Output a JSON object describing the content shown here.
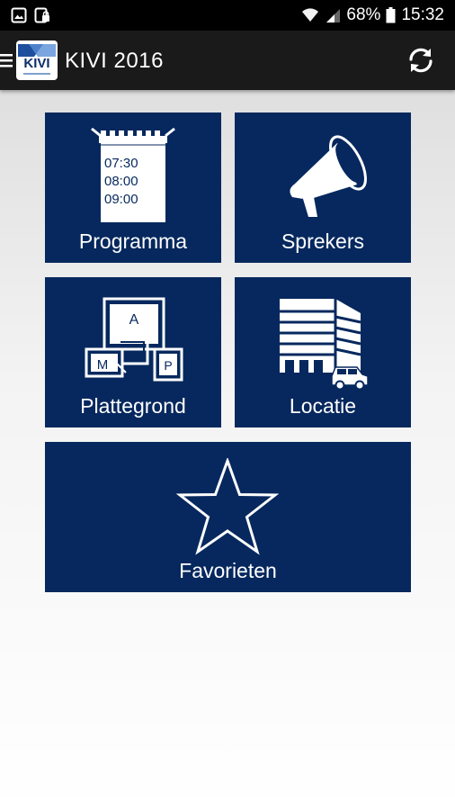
{
  "status_bar": {
    "left_icons": [
      "image-icon",
      "lock-notification-icon"
    ],
    "wifi_icon": "wifi-icon",
    "signal_icon": "signal-icon",
    "battery_percent": "68%",
    "battery_icon": "battery-icon",
    "time": "15:32"
  },
  "app_bar": {
    "menu_icon": "hamburger-menu-icon",
    "logo_text": "KIVI",
    "title": "KIVI 2016",
    "refresh_icon": "refresh-icon"
  },
  "tiles": [
    {
      "label": "Programma",
      "icon": "schedule-icon",
      "times": [
        "07:30",
        "08:00",
        "09:00"
      ]
    },
    {
      "label": "Sprekers",
      "icon": "megaphone-icon"
    },
    {
      "label": "Plattegrond",
      "icon": "floorplan-icon",
      "rooms": [
        "A",
        "M",
        "P"
      ]
    },
    {
      "label": "Locatie",
      "icon": "building-car-icon"
    },
    {
      "label": "Favorieten",
      "icon": "star-icon"
    }
  ],
  "colors": {
    "tile_background": "#06285e",
    "status_bar": "#000000",
    "app_bar": "#1a1a1a"
  }
}
